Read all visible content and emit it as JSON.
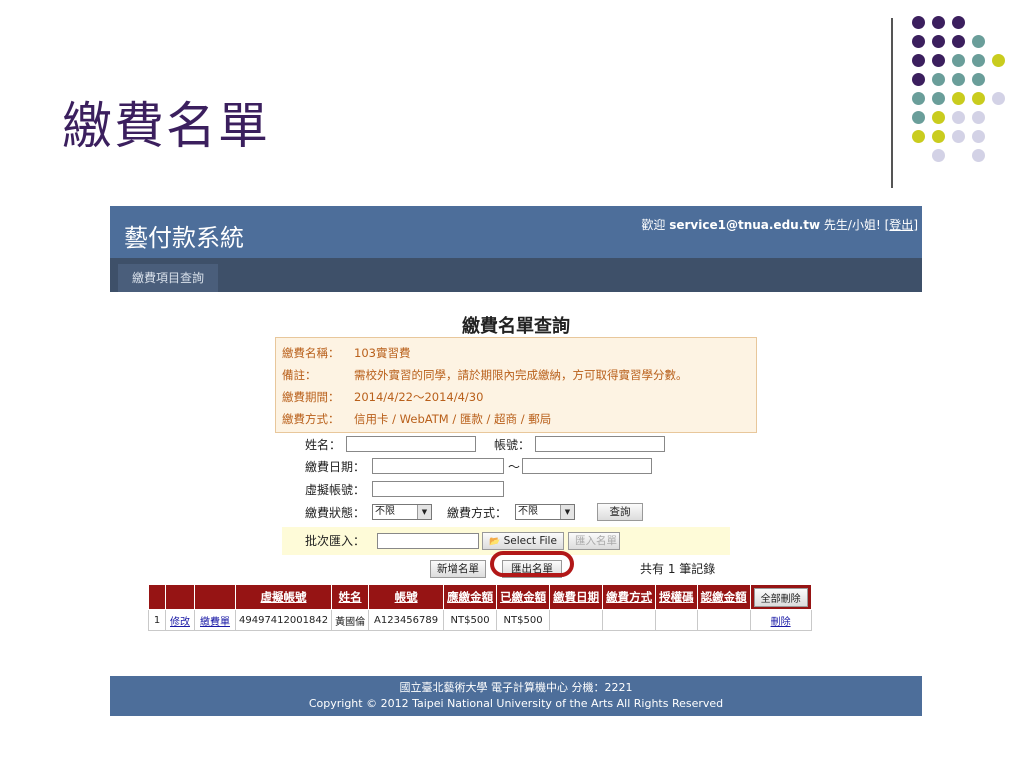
{
  "slide": {
    "title": "繳費名單"
  },
  "app": {
    "title": "藝付款系統",
    "welcome_prefix": "歡迎",
    "user": "service1@tnua.edu.tw",
    "salutation": "先生/小姐!",
    "logout_open": "[",
    "logout_label": "登出",
    "logout_close": "]",
    "nav": [
      "繳費項目查詢"
    ]
  },
  "query": {
    "title": "繳費名單查詢",
    "info": [
      {
        "label": "繳費名稱：",
        "value": "103實習費"
      },
      {
        "label": "備註：",
        "value": "需校外實習的同學，請於期限內完成繳納，方可取得實習學分數。"
      },
      {
        "label": "繳費期間：",
        "value": "2014/4/22～2014/4/30"
      },
      {
        "label": "繳費方式：",
        "value": "信用卡 / WebATM / 匯款 / 超商 / 郵局"
      }
    ]
  },
  "form": {
    "name_label": "姓名：",
    "account_label": "帳號：",
    "date_label": "繳費日期：",
    "date_sep": "～",
    "virtual_label": "虛擬帳號：",
    "status_label": "繳費狀態：",
    "status_value": "不限",
    "method_label": "繳費方式：",
    "method_value": "不限",
    "search_button": "查詢",
    "batch_label": "批次匯入：",
    "select_file_button": "Select File",
    "import_button": "匯入名單",
    "add_button": "新增名單",
    "export_button": "匯出名單",
    "record_count": "共有 1 筆記錄"
  },
  "table": {
    "headers": [
      "虛擬帳號",
      "姓名",
      "帳號",
      "應繳金額",
      "已繳金額",
      "繳費日期",
      "繳費方式",
      "授權碼",
      "認繳金額"
    ],
    "delete_all": "全部刪除",
    "rows": [
      {
        "index": "1",
        "edit": "修改",
        "bill": "繳費單",
        "virtual": "49497412001842",
        "name": "黃國倫",
        "account": "A123456789",
        "due": "NT$500",
        "paid": "NT$500",
        "date": "",
        "method": "",
        "auth": "",
        "pledge": "",
        "delete": "刪除"
      }
    ]
  },
  "footer": {
    "line1": "國立臺北藝術大學 電子計算機中心 分機：2221",
    "line2": "Copyright © 2012 Taipei National University of the Arts All Rights Reserved"
  },
  "colors": {
    "accent_purple": "#3b1f5e",
    "header_blue": "#4d6e9a",
    "table_header_red": "#961414",
    "highlight_red": "#b21818",
    "dot_teal": "#6a9e9a",
    "dot_yellow": "#c9cc1e",
    "dot_lilac": "#d3d2e6"
  }
}
